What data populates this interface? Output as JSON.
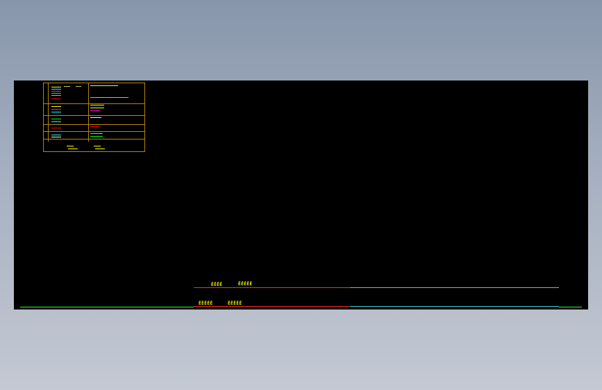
{
  "canvas": {
    "background": "#000000",
    "frame_color": "#b8860b"
  },
  "legend": {
    "rows": [
      {
        "color": "#ffff00"
      },
      {
        "color": "#00ffff"
      },
      {
        "color": "#ff00ff"
      },
      {
        "color": "#00ff00"
      },
      {
        "color": "#ff0000"
      },
      {
        "color": "#ffffff"
      }
    ]
  },
  "drawing": {
    "upper_labels": [
      {
        "text": "ĒĒĒĒ",
        "color": "#ffff00"
      },
      {
        "text": "ĒĒĒĒĒ",
        "color": "#ffff00"
      }
    ],
    "lower_labels": [
      {
        "text": "ĒĒĒĒĒ",
        "color": "#ffff00"
      },
      {
        "text": "ĒĒĒĒĒ",
        "color": "#ffff00"
      }
    ],
    "line_colors": {
      "red": "#ff2a2a",
      "cyan": "#38d6d6",
      "green": "#22ff22"
    }
  }
}
